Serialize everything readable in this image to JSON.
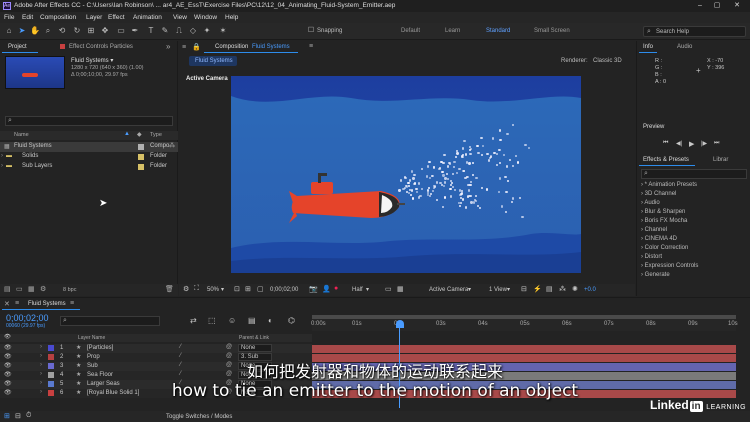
{
  "app": {
    "title": "Adobe After Effects CC - C:\\Users\\Ian Robinson\\ ... ar4_AE_EssT\\Exercise Files\\PC\\12\\12_04_Animating_Fluid-System_Emitter.aep",
    "logo": "Ae",
    "window_buttons": [
      "–",
      "▢",
      "✕"
    ]
  },
  "menu": [
    "File",
    "Edit",
    "Composition",
    "Layer",
    "Effect",
    "Animation",
    "View",
    "Window",
    "Help"
  ],
  "toolbar": {
    "snapping": "Snapping",
    "workspaces": [
      "Default",
      "Learn",
      "Standard",
      "Small Screen"
    ],
    "active_workspace": "Standard",
    "search_placeholder": "Search Help"
  },
  "project_panel": {
    "tab_project": "Project",
    "tab_effect_controls": "Effect Controls Particles",
    "comp_name": "Fluid Systems ▾",
    "comp_info_1": "1280 x 720  (640 x 360) (1.00)",
    "comp_info_2": "Δ 0;00;10;00, 29.97 fps",
    "search_placeholder": "",
    "col_name": "Name",
    "col_type": "Type",
    "items": [
      {
        "name": "Fluid Systems",
        "type": "Compo",
        "color": "#b0b0b0"
      },
      {
        "name": "Solids",
        "type": "Folder",
        "color": "#d6c066"
      },
      {
        "name": "Sub Layers",
        "type": "Folder",
        "color": "#d6c066"
      }
    ],
    "bpc": "8 bpc"
  },
  "composition_panel": {
    "tab": "Composition",
    "tab_name": "Fluid Systems",
    "breadcrumb": "Fluid Systems",
    "renderer_label": "Renderer:",
    "renderer_value": "Classic 3D",
    "active_camera": "Active Camera",
    "zoom": "50%",
    "timecode": "0;00;02;00",
    "resolution": "Half",
    "camera_view": "Active Camera",
    "views": "1 View",
    "exposure": "+0.0"
  },
  "info_panel": {
    "tab_info": "Info",
    "tab_audio": "Audio",
    "r": "R :",
    "g": "G :",
    "b": "B :",
    "a": "A :  0",
    "x": "X : -70",
    "y": "Y : 396"
  },
  "preview_panel": {
    "title": "Preview",
    "controls": [
      "⏮",
      "◀|",
      "▶",
      "|▶",
      "⏭"
    ]
  },
  "effects_panel": {
    "tab": "Effects & Presets",
    "tab2": "Librar",
    "search_placeholder": "",
    "items": [
      "* Animation Presets",
      "3D Channel",
      "Audio",
      "Blur & Sharpen",
      "Boris FX Mocha",
      "Channel",
      "CINEMA 4D",
      "Color Correction",
      "Distort",
      "Expression Controls",
      "Generate"
    ]
  },
  "timeline": {
    "tab": "Fluid Systems",
    "timecode": "0;00;02;00",
    "frame_info": "00060 (29.97 fps)",
    "search_placeholder": "",
    "col_layer_name": "Layer Name",
    "col_parent": "Parent & Link",
    "ruler": [
      "0:00s",
      "01s",
      "02s",
      "03s",
      "04s",
      "05s",
      "06s",
      "07s",
      "08s",
      "09s",
      "10s"
    ],
    "layers": [
      {
        "num": "1",
        "name": "[Particles]",
        "color": "#4a4ad0",
        "parent": "None",
        "bar": "#c05050"
      },
      {
        "num": "2",
        "name": "Prop",
        "color": "#b64040",
        "parent": "3. Sub",
        "bar": "#c05050"
      },
      {
        "num": "3",
        "name": "Sub",
        "color": "#6a6ad0",
        "parent": "None",
        "bar": "#7070c8"
      },
      {
        "num": "4",
        "name": "Sea Floor",
        "color": "#a0a0a0",
        "parent": "None",
        "bar": "#8a8a8a"
      },
      {
        "num": "5",
        "name": "Larger Seas",
        "color": "#5a7ad0",
        "parent": "None",
        "bar": "#6a78c0"
      },
      {
        "num": "6",
        "name": "[Royal Blue Solid 1]",
        "color": "#c84040",
        "parent": "None",
        "bar": "#c05050"
      }
    ],
    "toggle_label": "Toggle Switches / Modes"
  },
  "subtitles": {
    "chinese": "如何把发射器和物体的运动联系起来",
    "english": "how to tie an emitter to the motion of an object"
  },
  "watermark": {
    "brand": "Linked",
    "in": "in",
    "learning": "LEARNING"
  },
  "colors": {
    "accent_blue": "#2d8ceb",
    "water_top": "#1e3f9e",
    "water_bottom": "#2a64b5",
    "seafloor": "#1c48a6",
    "submarine": "#e5442a"
  }
}
